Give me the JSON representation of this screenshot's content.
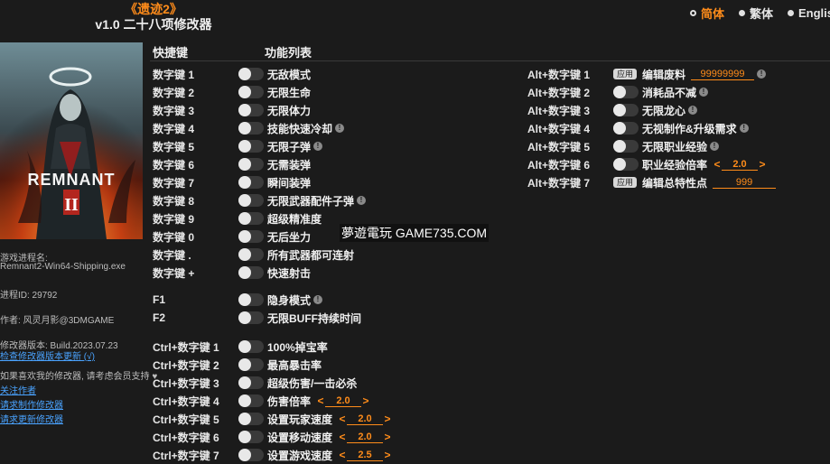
{
  "header": {
    "game_title": "《遗迹2》",
    "version_line": "v1.0 二十八项修改器"
  },
  "languages": [
    {
      "label": "简体",
      "active": true
    },
    {
      "label": "繁体",
      "active": false
    },
    {
      "label": "English",
      "active": false
    }
  ],
  "cover": {
    "logo_text": "REMNANT"
  },
  "sidebar": {
    "process_label": "游戏进程名:",
    "process_name": "Remnant2-Win64-Shipping.exe",
    "pid": "进程ID: 29792",
    "author": "作者: 风灵月影@3DMGAME",
    "trainer_version": "修改器版本: Build.2023.07.23",
    "check_update_link": "检查修改器版本更新 (√)",
    "support_text": "如果喜欢我的修改器, 请考虑会员支持 ♥",
    "link_author": "关注作者",
    "link_request": "请求制作修改器",
    "link_more": "请求更新修改器"
  },
  "columns": {
    "hotkey": "快捷键",
    "function": "功能列表"
  },
  "left_cheats": [
    {
      "key": "数字键 1",
      "label": "无敌模式",
      "info": false
    },
    {
      "key": "数字键 2",
      "label": "无限生命",
      "info": false
    },
    {
      "key": "数字键 3",
      "label": "无限体力",
      "info": false
    },
    {
      "key": "数字键 4",
      "label": "技能快速冷却",
      "info": true
    },
    {
      "key": "数字键 5",
      "label": "无限子弹",
      "info": true
    },
    {
      "key": "数字键 6",
      "label": "无需装弹",
      "info": false
    },
    {
      "key": "数字键 7",
      "label": "瞬间装弹",
      "info": false
    },
    {
      "key": "数字键 8",
      "label": "无限武器配件子弹",
      "info": true
    },
    {
      "key": "数字键 9",
      "label": "超级精准度",
      "info": false
    },
    {
      "key": "数字键 0",
      "label": "无后坐力",
      "info": false
    },
    {
      "key": "数字键 .",
      "label": "所有武器都可连射",
      "info": false
    },
    {
      "key": "数字键 +",
      "label": "快速射击",
      "info": false
    }
  ],
  "f_cheats": [
    {
      "key": "F1",
      "label": "隐身模式",
      "info": true
    },
    {
      "key": "F2",
      "label": "无限BUFF持续时间",
      "info": false
    }
  ],
  "ctrl_cheats": [
    {
      "key": "Ctrl+数字键 1",
      "label": "100%掉宝率"
    },
    {
      "key": "Ctrl+数字键 2",
      "label": "最高暴击率"
    },
    {
      "key": "Ctrl+数字键 3",
      "label": "超级伤害/一击必杀"
    },
    {
      "key": "Ctrl+数字键 4",
      "label": "伤害倍率",
      "value": "2.0"
    },
    {
      "key": "Ctrl+数字键 5",
      "label": "设置玩家速度",
      "value": "2.0"
    },
    {
      "key": "Ctrl+数字键 6",
      "label": "设置移动速度",
      "value": "2.0"
    },
    {
      "key": "Ctrl+数字键 7",
      "label": "设置游戏速度",
      "value": "2.5"
    }
  ],
  "alt_cheats": [
    {
      "key": "Alt+数字键 1",
      "label": "编辑废料",
      "apply": "应用",
      "value": "99999999",
      "info": true
    },
    {
      "key": "Alt+数字键 2",
      "label": "消耗品不减",
      "info": true
    },
    {
      "key": "Alt+数字键 3",
      "label": "无限龙心",
      "info": true
    },
    {
      "key": "Alt+数字键 4",
      "label": "无视制作&升级需求",
      "info": true
    },
    {
      "key": "Alt+数字键 5",
      "label": "无限职业经验",
      "info": true
    },
    {
      "key": "Alt+数字键 6",
      "label": "职业经验倍率",
      "value": "2.0"
    },
    {
      "key": "Alt+数字键 7",
      "label": "编辑总特性点",
      "apply": "应用",
      "value": "999"
    }
  ],
  "watermark": "夢遊電玩 GAME735.COM",
  "colors": {
    "accent": "#ff8c1a",
    "background": "#1b1b1b",
    "link": "#4aa3ff"
  }
}
